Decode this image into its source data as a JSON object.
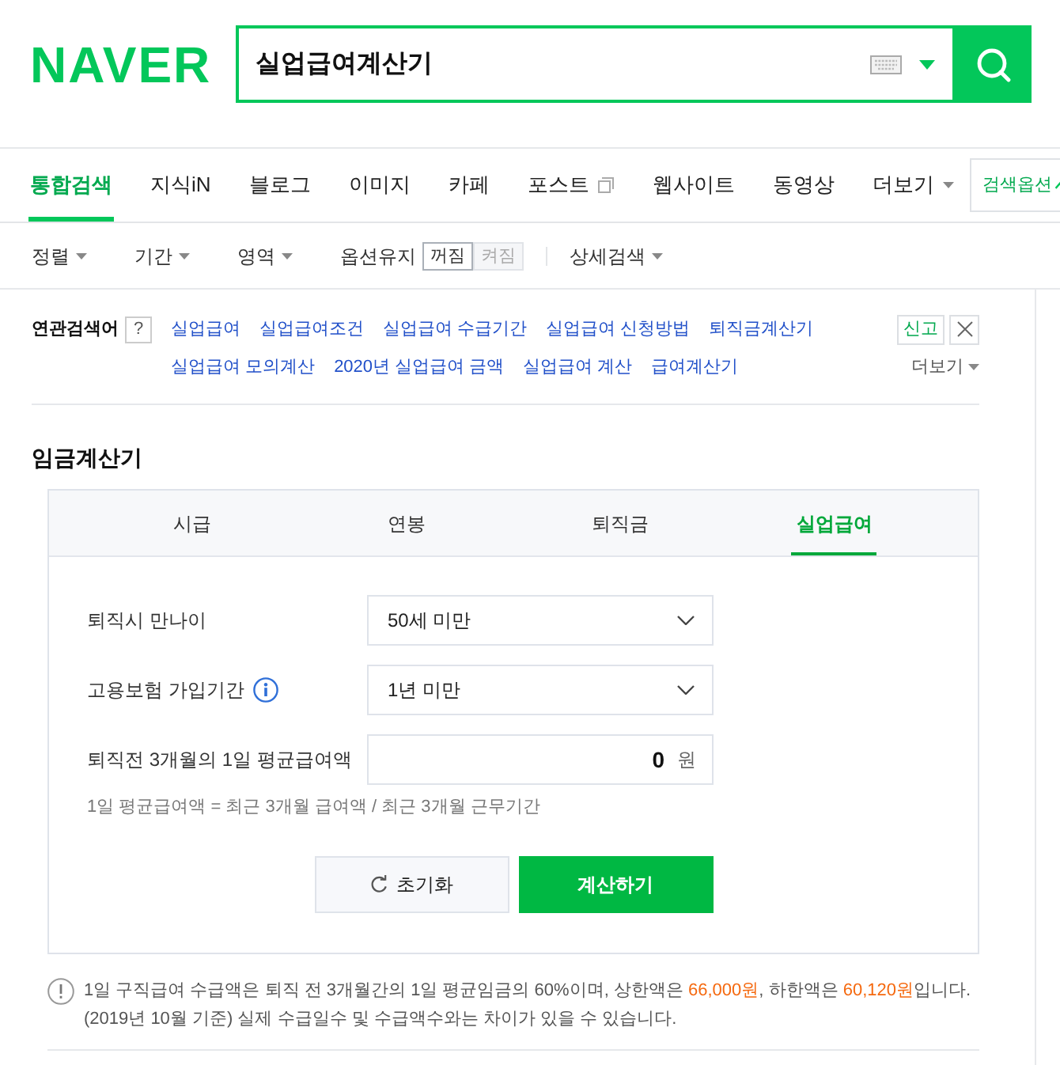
{
  "logo": "NAVER",
  "search": {
    "value": "실업급여계산기"
  },
  "tabs": [
    {
      "label": "통합검색",
      "selected": true,
      "kind": "plain"
    },
    {
      "label": "지식iN",
      "selected": false,
      "kind": "plain"
    },
    {
      "label": "블로그",
      "selected": false,
      "kind": "plain"
    },
    {
      "label": "이미지",
      "selected": false,
      "kind": "plain"
    },
    {
      "label": "카페",
      "selected": false,
      "kind": "plain"
    },
    {
      "label": "포스트",
      "selected": false,
      "kind": "icon"
    },
    {
      "label": "웹사이트",
      "selected": false,
      "kind": "plain"
    },
    {
      "label": "동영상",
      "selected": false,
      "kind": "plain"
    },
    {
      "label": "더보기",
      "selected": false,
      "kind": "dropdown"
    }
  ],
  "search_options": {
    "label": "검색옵션"
  },
  "filters": [
    {
      "label": "정렬",
      "kind": "dropdown"
    },
    {
      "label": "기간",
      "kind": "dropdown"
    },
    {
      "label": "영역",
      "kind": "dropdown"
    },
    {
      "label": "옵션유지",
      "kind": "toggle",
      "options": [
        {
          "label": "꺼짐",
          "selected": true
        },
        {
          "label": "켜짐",
          "selected": false
        }
      ]
    },
    {
      "label": "상세검색",
      "kind": "dropdown"
    }
  ],
  "related": {
    "label": "연관검색어",
    "help": "?",
    "links": [
      "실업급여",
      "실업급여조건",
      "실업급여 수급기간",
      "실업급여 신청방법",
      "퇴직금계산기",
      "실업급여 모의계산",
      "2020년 실업급여 금액",
      "실업급여 계산",
      "급여계산기"
    ],
    "report": "신고",
    "more": "더보기"
  },
  "calculator": {
    "title": "임금계산기",
    "tabs": [
      {
        "label": "시급",
        "selected": false
      },
      {
        "label": "연봉",
        "selected": false
      },
      {
        "label": "퇴직금",
        "selected": false
      },
      {
        "label": "실업급여",
        "selected": true
      }
    ],
    "fields": [
      {
        "kind": "select",
        "label": "퇴직시 만나이",
        "value": "50세 미만",
        "info": false
      },
      {
        "kind": "select",
        "label": "고용보험 가입기간",
        "value": "1년 미만",
        "info": true
      },
      {
        "kind": "number",
        "label": "퇴직전 3개월의 1일 평균급여액",
        "value": "0",
        "unit": "원",
        "info": false
      }
    ],
    "hint": "1일 평균급여액 = 최근 3개월 급여액 / 최근 3개월 근무기간",
    "buttons": [
      {
        "label": "초기화",
        "kind": "reset"
      },
      {
        "label": "계산하기",
        "kind": "primary"
      }
    ]
  },
  "notice": {
    "segments": [
      {
        "text": "1일 구직급여 수급액은 퇴직 전 3개월간의 1일 평균임금의 60%이며, 상한액은 ",
        "highlight": false
      },
      {
        "text": "66,000원",
        "highlight": true
      },
      {
        "text": ", 하한액은 ",
        "highlight": false
      },
      {
        "text": "60,120원",
        "highlight": true
      },
      {
        "text": "입니다. (2019년 10월 기준) 실제 수급일수 및 수급액수와는 차이가 있을 수 있습니다.",
        "highlight": false
      }
    ]
  }
}
